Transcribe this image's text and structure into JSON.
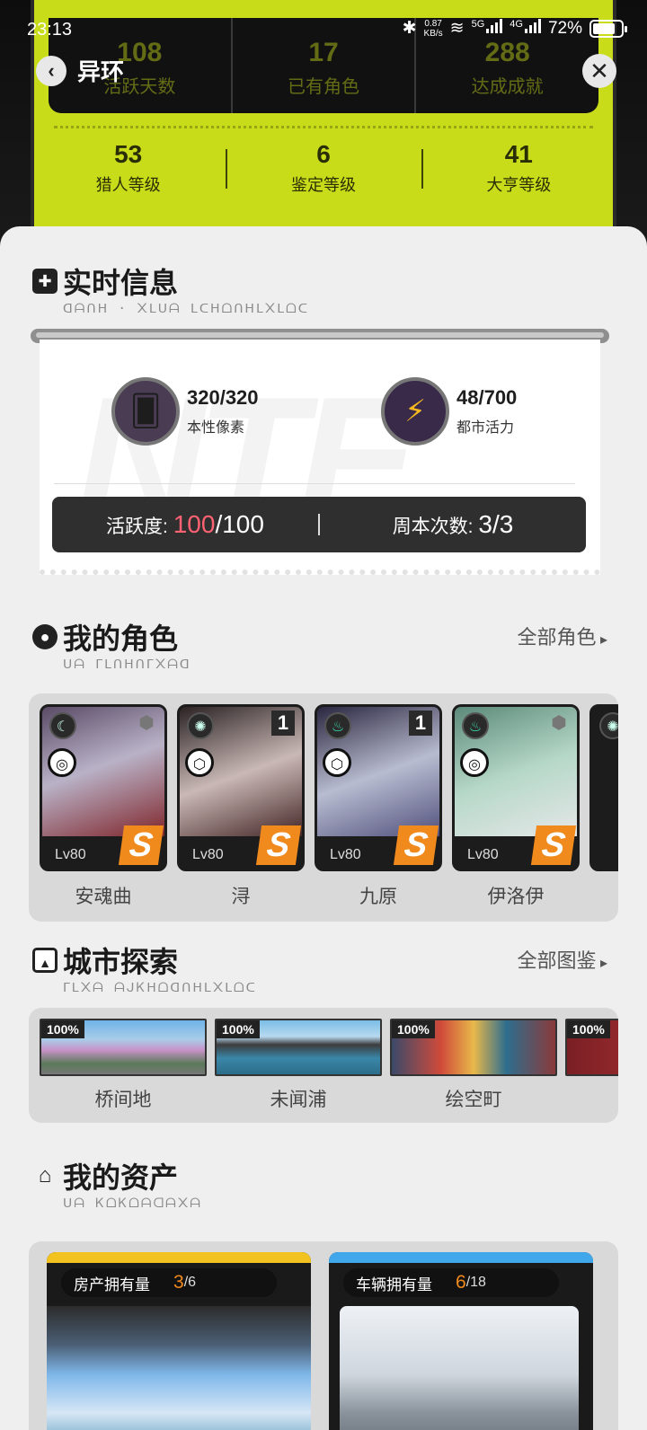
{
  "status_bar": {
    "time": "23:13",
    "net_speed_top": "0.87",
    "net_speed_unit": "KB/s",
    "sim1": "5G",
    "sim2": "4G",
    "battery": "72%"
  },
  "header": {
    "title": "异环",
    "prev_stats": [
      {
        "value": "108",
        "label": "活跃天数"
      },
      {
        "value": "17",
        "label": "已有角色"
      },
      {
        "value": "288",
        "label": "达成成就"
      }
    ],
    "levels": [
      {
        "value": "53",
        "label": "猎人等级"
      },
      {
        "value": "6",
        "label": "鉴定等级"
      },
      {
        "value": "41",
        "label": "大亨等级"
      }
    ]
  },
  "realtime": {
    "title": "实时信息",
    "subtitle": "ᗡᗩᑎᕼ · ᙭ᒪᑌᗩ ᒪᑕᕼᗝᑎᕼᒪ᙭ᒪᗝᑕ",
    "resources": [
      {
        "value": "320/320",
        "label": "本性像素",
        "icon": "pixel-card-icon"
      },
      {
        "value": "48/700",
        "label": "都市活力",
        "icon": "lightning-orb-icon"
      }
    ],
    "activity_label": "活跃度:",
    "activity_value": "100",
    "activity_total": "/100",
    "weekly_label": "周本次数:",
    "weekly_value": "3/3"
  },
  "characters": {
    "title": "我的角色",
    "subtitle": "ᑌᗩ ᒥᒪᑎᕼᑎᒥ᙭ᗩᗡ",
    "link": "全部角色",
    "items": [
      {
        "name": "安魂曲",
        "level": "Lv80",
        "rank": "",
        "art": "#b9b2c7"
      },
      {
        "name": "浔",
        "level": "Lv80",
        "rank": "1",
        "art": "#c9b8b5"
      },
      {
        "name": "九原",
        "level": "Lv80",
        "rank": "1",
        "art": "#b8bcd0"
      },
      {
        "name": "伊洛伊",
        "level": "Lv80",
        "rank": "",
        "art": "#b6d8c8"
      }
    ]
  },
  "city": {
    "title": "城市探索",
    "subtitle": "ᒥᒪ᙭ᗩ ᗩᒍᏦᕼᗝᗡᑎᕼᒪ᙭ᒪᗝᑕ",
    "link": "全部图鉴",
    "items": [
      {
        "name": "桥间地",
        "percent": "100%"
      },
      {
        "name": "未闻浦",
        "percent": "100%"
      },
      {
        "name": "绘空町",
        "percent": "100%"
      },
      {
        "name": "",
        "percent": "100%"
      }
    ]
  },
  "assets": {
    "title": "我的资产",
    "subtitle": "ᑌᗩ ᏦᗝᏦᗝᗩᗡᗩ᙭ᗩ",
    "property_label": "房产拥有量",
    "property_count": "3",
    "property_total": "/6",
    "vehicle_label": "车辆拥有量",
    "vehicle_count": "6",
    "vehicle_total": "/18"
  }
}
